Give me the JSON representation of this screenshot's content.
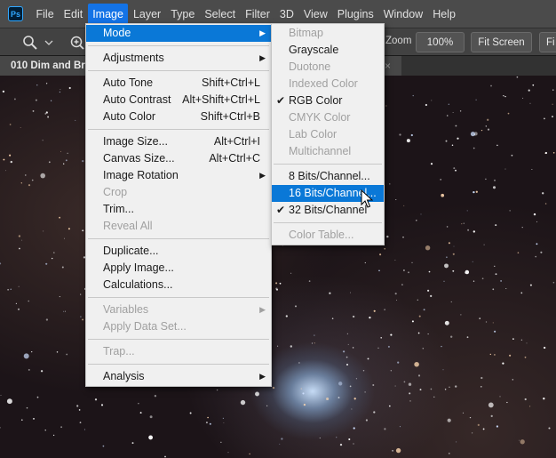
{
  "app": {
    "logo_text": "Ps",
    "menubar": [
      "File",
      "Edit",
      "Image",
      "Layer",
      "Type",
      "Select",
      "Filter",
      "3D",
      "View",
      "Plugins",
      "Window",
      "Help"
    ],
    "active_menu": "Image"
  },
  "options_bar": {
    "zoom_label": "Zoom",
    "zoom_value": "100%",
    "fit_screen": "Fit Screen",
    "fill_screen": "Fi"
  },
  "document": {
    "tab_title": "010 Dim and Bri",
    "tab_close": "×"
  },
  "image_menu": [
    {
      "label": "Mode",
      "submenu": true,
      "highlighted": true
    },
    {
      "sep": true
    },
    {
      "label": "Adjustments",
      "submenu": true
    },
    {
      "sep": true
    },
    {
      "label": "Auto Tone",
      "shortcut": "Shift+Ctrl+L"
    },
    {
      "label": "Auto Contrast",
      "shortcut": "Alt+Shift+Ctrl+L"
    },
    {
      "label": "Auto Color",
      "shortcut": "Shift+Ctrl+B"
    },
    {
      "sep": true
    },
    {
      "label": "Image Size...",
      "shortcut": "Alt+Ctrl+I"
    },
    {
      "label": "Canvas Size...",
      "shortcut": "Alt+Ctrl+C"
    },
    {
      "label": "Image Rotation",
      "submenu": true
    },
    {
      "label": "Crop",
      "disabled": true
    },
    {
      "label": "Trim..."
    },
    {
      "label": "Reveal All",
      "disabled": true
    },
    {
      "sep": true
    },
    {
      "label": "Duplicate..."
    },
    {
      "label": "Apply Image..."
    },
    {
      "label": "Calculations..."
    },
    {
      "sep": true
    },
    {
      "label": "Variables",
      "submenu": true,
      "disabled": true
    },
    {
      "label": "Apply Data Set...",
      "disabled": true
    },
    {
      "sep": true
    },
    {
      "label": "Trap...",
      "disabled": true
    },
    {
      "sep": true
    },
    {
      "label": "Analysis",
      "submenu": true
    }
  ],
  "mode_submenu": [
    {
      "label": "Bitmap",
      "disabled": true
    },
    {
      "label": "Grayscale"
    },
    {
      "label": "Duotone",
      "disabled": true
    },
    {
      "label": "Indexed Color",
      "disabled": true
    },
    {
      "label": "RGB Color",
      "checked": true
    },
    {
      "label": "CMYK Color",
      "disabled": true
    },
    {
      "label": "Lab Color",
      "disabled": true
    },
    {
      "label": "Multichannel",
      "disabled": true
    },
    {
      "sep": true
    },
    {
      "label": "8 Bits/Channel..."
    },
    {
      "label": "16 Bits/Channel...",
      "highlighted": true
    },
    {
      "label": "32 Bits/Channel",
      "checked": true
    },
    {
      "sep": true
    },
    {
      "label": "Color Table...",
      "disabled": true
    }
  ],
  "colors": {
    "menubar_bg": "#4b4b4b",
    "menu_highlight": "#0a78d7",
    "menu_bg": "#f0f0f0",
    "active_menubar_item": "#1473e6"
  }
}
